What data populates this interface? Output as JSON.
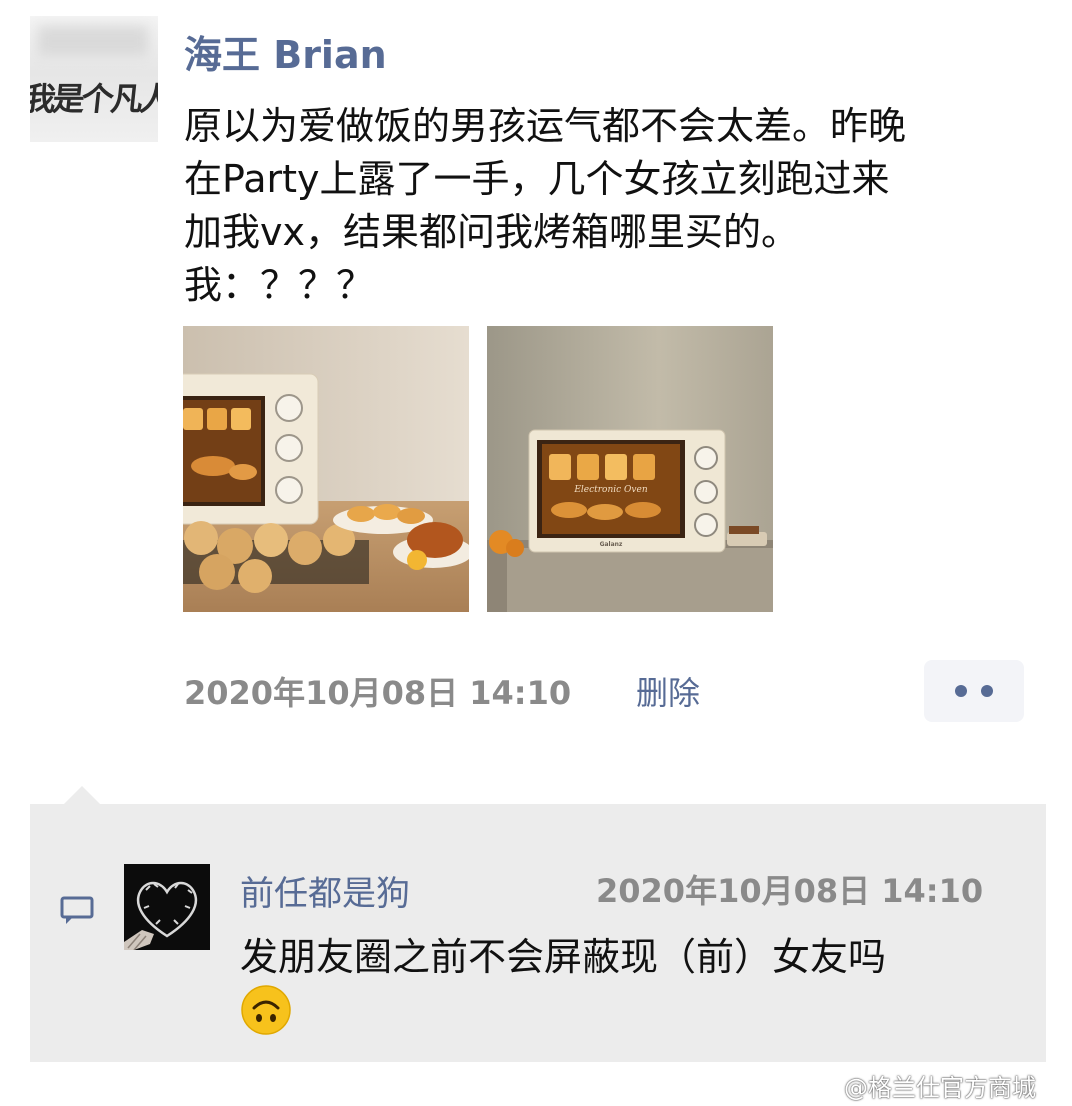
{
  "post": {
    "author_name": "海王 Brian",
    "author_avatar_text": "我是个凡人",
    "text_lines": [
      "原以为爱做饭的男孩运气都不会太差。昨晚",
      "在Party上露了一手，几个女孩立刻跑过来",
      "加我vx，结果都问我烤箱哪里买的。",
      "我：？？？"
    ],
    "photo2_oven_label": "Electronic Oven",
    "photo2_brand": "Galanz",
    "timestamp": "2020年10月08日 14:10",
    "delete_label": "删除",
    "more_icon": "more-dots-icon"
  },
  "comment": {
    "author_name": "前任都是狗",
    "timestamp": "2020年10月08日 14:10",
    "text": "发朋友圈之前不会屏蔽现（前）女友吗",
    "emoji": "upside-down-face-emoji",
    "comment_icon": "comment-bubble-icon"
  },
  "watermark": {
    "text": "@格兰仕官方商城"
  },
  "colors": {
    "link_blue": "#576b95",
    "timestamp_gray": "#8a8a8a",
    "comment_bg": "#ececec",
    "more_button_bg": "#f3f4f8"
  }
}
